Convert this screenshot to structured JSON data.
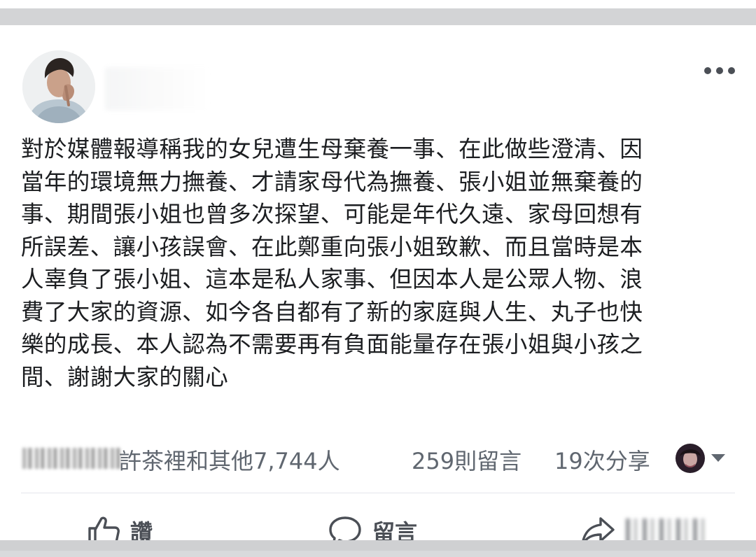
{
  "post": {
    "author_avatar": "person-photo-avatar",
    "more_menu": "more-dots-icon",
    "text": "對於媒體報導稱我的女兒遭生母棄養一事、在此做些澄清、因\n當年的環境無力撫養、才請家母代為撫養、張小姐並無棄養的\n事、期間張小姐也曾多次探望、可能是年代久遠、家母回想有\n所誤差、讓小孩誤會、在此鄭重向張小姐致歉、而且當時是本\n人辜負了張小姐、這本是私人家事、但因本人是公眾人物、浪\n費了大家的資源、如今各自都有了新的家庭與人生、丸子也快\n樂的成長、本人認為不需要再有負面能量存在張小姐與小孩之\n間、謝謝大家的關心"
  },
  "stats": {
    "reactions": "許茶裡和其他7,744人",
    "comments": "259則留言",
    "shares": "19次分享"
  },
  "actions": {
    "like": {
      "label": "讚",
      "icon": "thumbs-up-icon"
    },
    "comment": {
      "label": "留言",
      "icon": "speech-bubble-icon"
    },
    "share": {
      "icon": "share-arrow-icon"
    }
  },
  "colors": {
    "text": "#1c1e21",
    "secondary": "#606770",
    "icon": "#4b4f56",
    "divider": "#e4e6eb"
  }
}
